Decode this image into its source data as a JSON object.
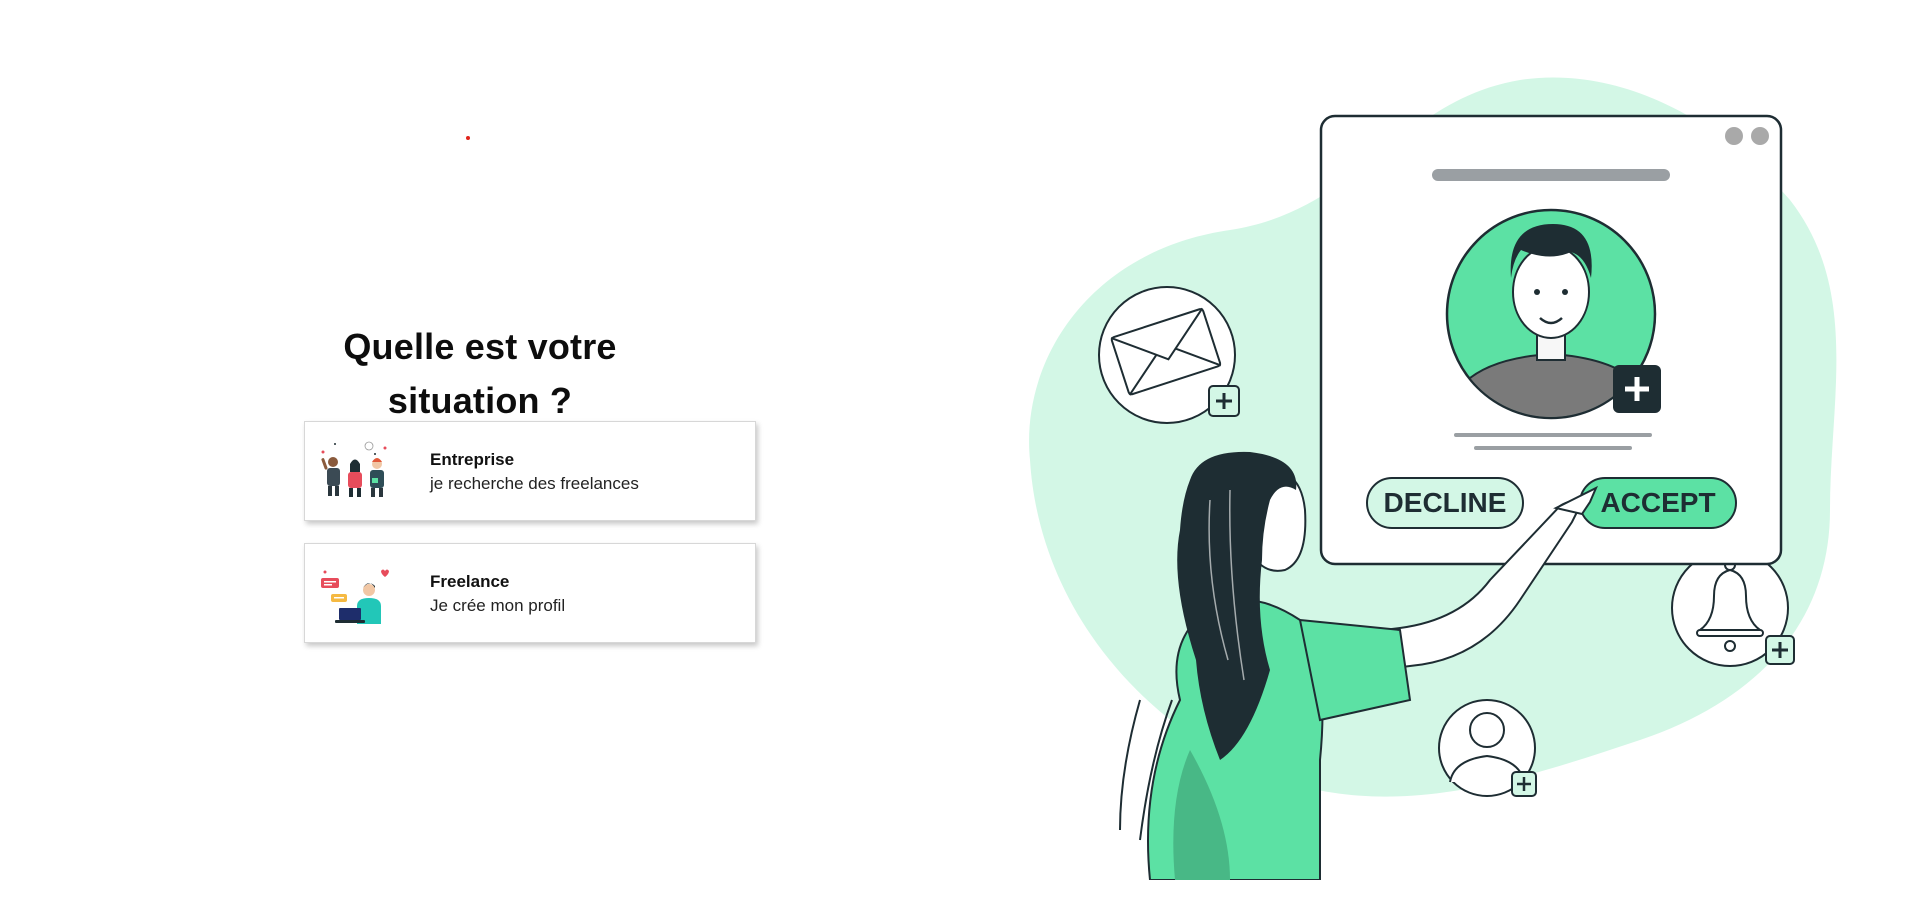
{
  "page": {
    "title_line1": "Quelle est votre",
    "title_line2": "situation ?"
  },
  "options": [
    {
      "title": "Entreprise",
      "subtitle": "je recherche des freelances",
      "illustration_icon": "team-illustration-icon"
    },
    {
      "title": "Freelance",
      "subtitle": "Je crée mon profil",
      "illustration_icon": "laptop-worker-illustration-icon"
    }
  ],
  "hero": {
    "decline_label": "DECLINE",
    "accept_label": "ACCEPT",
    "accent_color": "#5ce1a4",
    "blob_color": "#d3f7e6",
    "dark_color": "#1e2d33"
  }
}
